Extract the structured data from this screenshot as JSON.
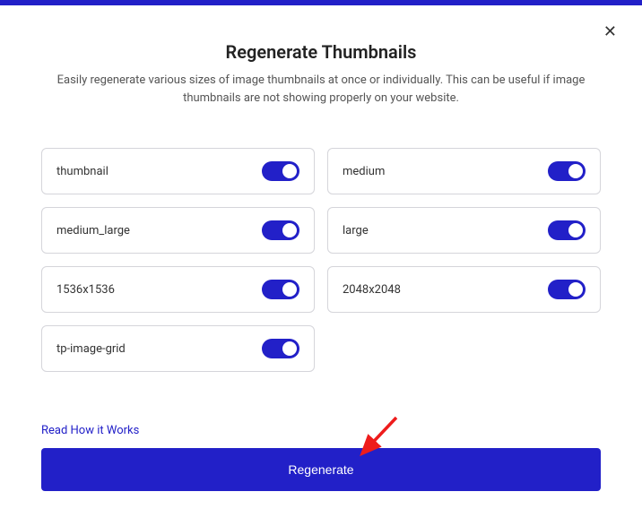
{
  "title": "Regenerate Thumbnails",
  "subtitle": "Easily regenerate various sizes of image thumbnails at once or individually. This can be useful if image thumbnails are not showing properly on your website.",
  "options": [
    {
      "label": "thumbnail"
    },
    {
      "label": "medium"
    },
    {
      "label": "medium_large"
    },
    {
      "label": "large"
    },
    {
      "label": "1536x1536"
    },
    {
      "label": "2048x2048"
    },
    {
      "label": "tp-image-grid"
    }
  ],
  "link_text": "Read How it Works",
  "button_label": "Regenerate"
}
